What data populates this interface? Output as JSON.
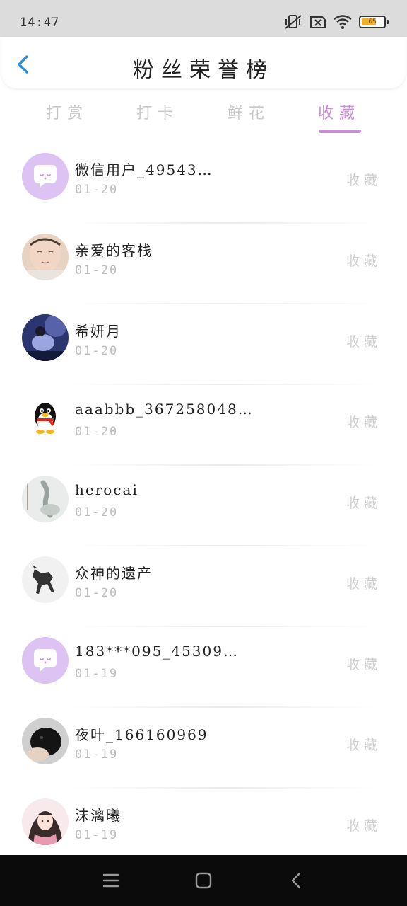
{
  "status_bar": {
    "time": "14:47",
    "battery": {
      "label": "65",
      "level_fraction": 0.65
    },
    "icons": [
      "mute-vibrate-icon",
      "sim-off-icon",
      "wifi-icon",
      "battery-icon"
    ]
  },
  "header": {
    "title": "粉丝荣誉榜",
    "back_icon": "chevron-left-icon"
  },
  "tabs": [
    {
      "label": "打赏",
      "active": false
    },
    {
      "label": "打卡",
      "active": false
    },
    {
      "label": "鲜花",
      "active": false
    },
    {
      "label": "收藏",
      "active": true
    }
  ],
  "fans": [
    {
      "name": "微信用户_49543…",
      "date": "01-20",
      "action": "收藏",
      "avatar": "wechat-default"
    },
    {
      "name": "亲爱的客栈",
      "date": "01-20",
      "action": "收藏",
      "avatar": "baby-photo"
    },
    {
      "name": "希妍月",
      "date": "01-20",
      "action": "收藏",
      "avatar": "girl-blue-photo"
    },
    {
      "name": "aaabbb_367258048…",
      "date": "01-20",
      "action": "收藏",
      "avatar": "qq-penguin"
    },
    {
      "name": "herocai",
      "date": "01-20",
      "action": "收藏",
      "avatar": "ink-painting"
    },
    {
      "name": "众神的遗产",
      "date": "01-20",
      "action": "收藏",
      "avatar": "horse-silhouette"
    },
    {
      "name": "183***095_45309…",
      "date": "01-19",
      "action": "收藏",
      "avatar": "wechat-default"
    },
    {
      "name": "夜叶_166160969",
      "date": "01-19",
      "action": "收藏",
      "avatar": "black-puppy"
    },
    {
      "name": "沫漓曦",
      "date": "01-19",
      "action": "收藏",
      "avatar": "anime-girl"
    }
  ],
  "colors": {
    "accent": "#c98ed8",
    "avatar_default_bg": "#dcc3f3",
    "status_bg": "#dcdcdc",
    "nav_bg": "#0b0b0b"
  },
  "nav_bar": {
    "buttons": [
      "menu-icon",
      "home-icon",
      "back-icon"
    ]
  }
}
